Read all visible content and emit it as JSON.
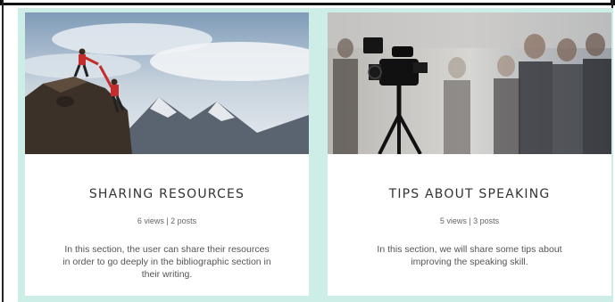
{
  "cards": [
    {
      "title": "SHARING RESOURCES",
      "meta": "6 views | 2 posts",
      "description": "In this section, the user can share their resources in order to go deeply in the bibliographic section in their writing.",
      "image_icon": "mountain-climbers-photo"
    },
    {
      "title": "TIPS ABOUT SPEAKING",
      "meta": "5 views | 3 posts",
      "description": "In this section, we will share some tips about improving the speaking skill.",
      "image_icon": "video-camera-audience-photo"
    }
  ],
  "colors": {
    "background": "#cdeee6",
    "card": "#ffffff",
    "title": "#333333"
  }
}
